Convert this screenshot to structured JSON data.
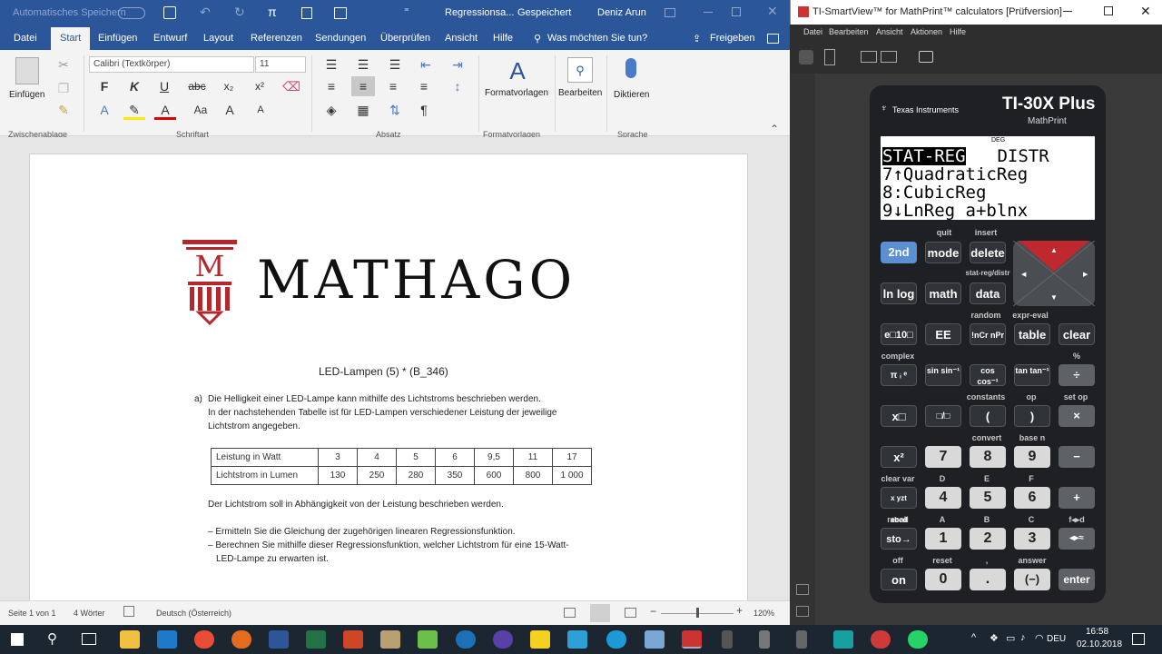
{
  "word": {
    "titlebar": {
      "autosave": "Automatisches Speichern",
      "autosave_state": "Aus",
      "doc_title": "Regressionsa...",
      "saved": "Gespeichert",
      "user": "Deniz Arun"
    },
    "tabs": [
      "Datei",
      "Start",
      "Einfügen",
      "Entwurf",
      "Layout",
      "Referenzen",
      "Sendungen",
      "Überprüfen",
      "Ansicht",
      "Hilfe"
    ],
    "tell_me": "Was möchten Sie tun?",
    "share": "Freigeben",
    "ribbon": {
      "paste": "Einfügen",
      "font": "Calibri (Textkörper)",
      "size": "11",
      "styles": "Formatvorlagen",
      "editing": "Bearbeiten",
      "dictate": "Diktieren",
      "groups": [
        "Zwischenablage",
        "Schriftart",
        "Absatz",
        "Formatvorlagen",
        "Sprache"
      ]
    },
    "doc": {
      "logo": "MATHAGO",
      "title": "LED-Lampen (5) * (B_346)",
      "part": "a)",
      "para1": [
        "Die Helligkeit einer LED-Lampe kann mithilfe des Lichtstroms beschrieben werden.",
        "In der nachstehenden Tabelle ist für LED-Lampen verschiedener Leistung der jeweilige",
        "Lichtstrom angegeben."
      ],
      "table": {
        "rows": [
          {
            "label": "Leistung in Watt",
            "values": [
              "3",
              "4",
              "5",
              "6",
              "9,5",
              "11",
              "17"
            ]
          },
          {
            "label": "Lichtstrom in Lumen",
            "values": [
              "130",
              "250",
              "280",
              "350",
              "600",
              "800",
              "1 000"
            ]
          }
        ]
      },
      "para2": "Der Lichtstrom soll in Abhängigkeit von der Leistung beschrieben werden.",
      "tasks": [
        "– Ermitteln Sie die Gleichung der zugehörigen linearen Regressionsfunktion.",
        "– Berechnen Sie mithilfe dieser Regressionsfunktion, welcher Lichtstrom für eine 15-Watt-",
        "LED-Lampe zu erwarten ist."
      ]
    },
    "status": {
      "page": "Seite 1 von 1",
      "words": "4 Wörter",
      "lang": "Deutsch (Österreich)",
      "zoom": "120%"
    }
  },
  "calc": {
    "window_title": "TI-SmartView™ for MathPrint™ calculators [Prüfversion]",
    "menu": [
      "Datei",
      "Bearbeiten",
      "Ansicht",
      "Aktionen",
      "Hilfe"
    ],
    "brand": "Texas Instruments",
    "model": "TI-30X Plus",
    "model_sub": "MathPrint",
    "lcd": {
      "mode": "DEG",
      "tab_selected": "STAT-REG",
      "tab_other": " DISTR",
      "lines": [
        "7↑QuadraticReg",
        "8:CubicReg",
        "9↓LnReg a+blnx"
      ]
    },
    "keys": {
      "r1": [
        "2nd",
        "mode",
        "delete"
      ],
      "r1_second": [
        "quit",
        "insert"
      ],
      "r2": [
        "ln log",
        "math",
        "data"
      ],
      "r2_second": [
        "stat-reg/distr"
      ],
      "r3": [
        "e□10□",
        "EE",
        "!nCr nPr",
        "table",
        "clear"
      ],
      "r3_second": [
        "random",
        "expr-eval"
      ],
      "r4": [
        "π ᵢ ᵉ",
        "sin sin⁻¹",
        "cos cos⁻¹",
        "tan tan⁻¹",
        "÷"
      ],
      "r4_second": [
        "complex",
        "%"
      ],
      "r5": [
        "x□",
        "□/□",
        "(",
        ")",
        "×"
      ],
      "r5_second": [
        "constants",
        "op",
        "set op"
      ],
      "r6": [
        "x²",
        "7",
        "8",
        "9",
        "−"
      ],
      "r6_second": [
        "convert",
        "base n"
      ],
      "r7": [
        "x yzt abcd",
        "4",
        "5",
        "6",
        "+"
      ],
      "r7_second": [
        "clear var",
        "D",
        "E",
        "F"
      ],
      "r8": [
        "sto→",
        "1",
        "2",
        "3",
        "◂▸≈"
      ],
      "r8_second": [
        "recall",
        "A",
        "B",
        "C",
        "f◂▸d"
      ],
      "r9": [
        "on",
        "0",
        ".",
        "(−)",
        "enter"
      ],
      "r9_second": [
        "off",
        "reset",
        ",",
        "answer"
      ]
    }
  },
  "taskbar": {
    "lang": "DEU",
    "time": "16:58",
    "date": "02.10.2018"
  }
}
